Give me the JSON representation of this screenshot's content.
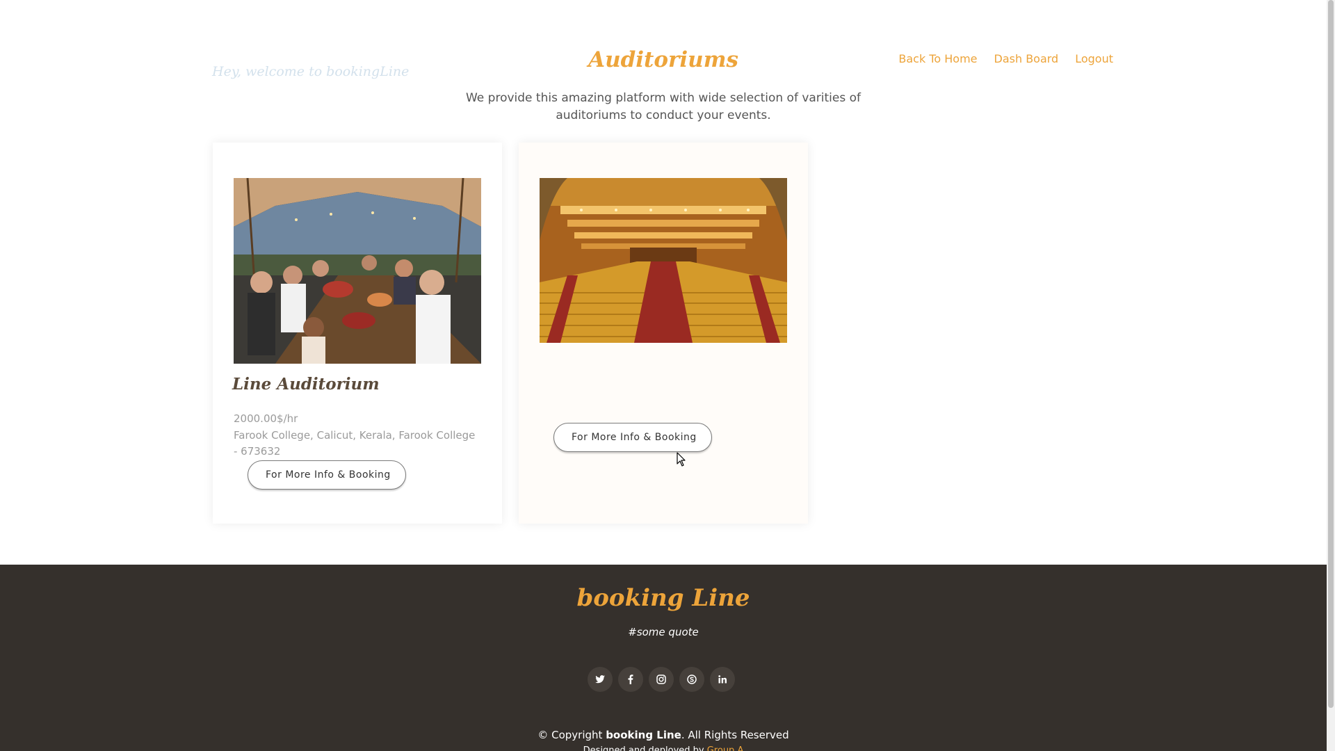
{
  "header": {
    "welcome": "Hey, welcome to bookingLine",
    "title": "Auditoriums",
    "subtitle": "We provide this amazing platform with wide selection of varities of auditoriums to conduct your events.",
    "nav": [
      "Back To Home",
      "Dash Board",
      "Logout"
    ]
  },
  "cards": [
    {
      "name": "Line Auditorium",
      "price": "2000.00$/hr",
      "address": "Farook College, Calicut, Kerala, Farook College - 673632",
      "button": "For More Info & Booking"
    },
    {
      "name": "",
      "price": "",
      "address": "",
      "button": "For More Info & Booking"
    }
  ],
  "footer": {
    "brand": "booking Line",
    "quote": "#some quote",
    "socials": [
      "twitter-icon",
      "facebook-icon",
      "instagram-icon",
      "skype-icon",
      "linkedin-icon"
    ],
    "copyright_prefix": "© Copyright ",
    "copyright_brand": "booking Line",
    "copyright_suffix": ". All Rights Reserved",
    "designed_prefix": "Designed and deployed by ",
    "designed_link": "Group A"
  },
  "colors": {
    "accent": "#eda43a",
    "footer_bg": "#35302c"
  }
}
